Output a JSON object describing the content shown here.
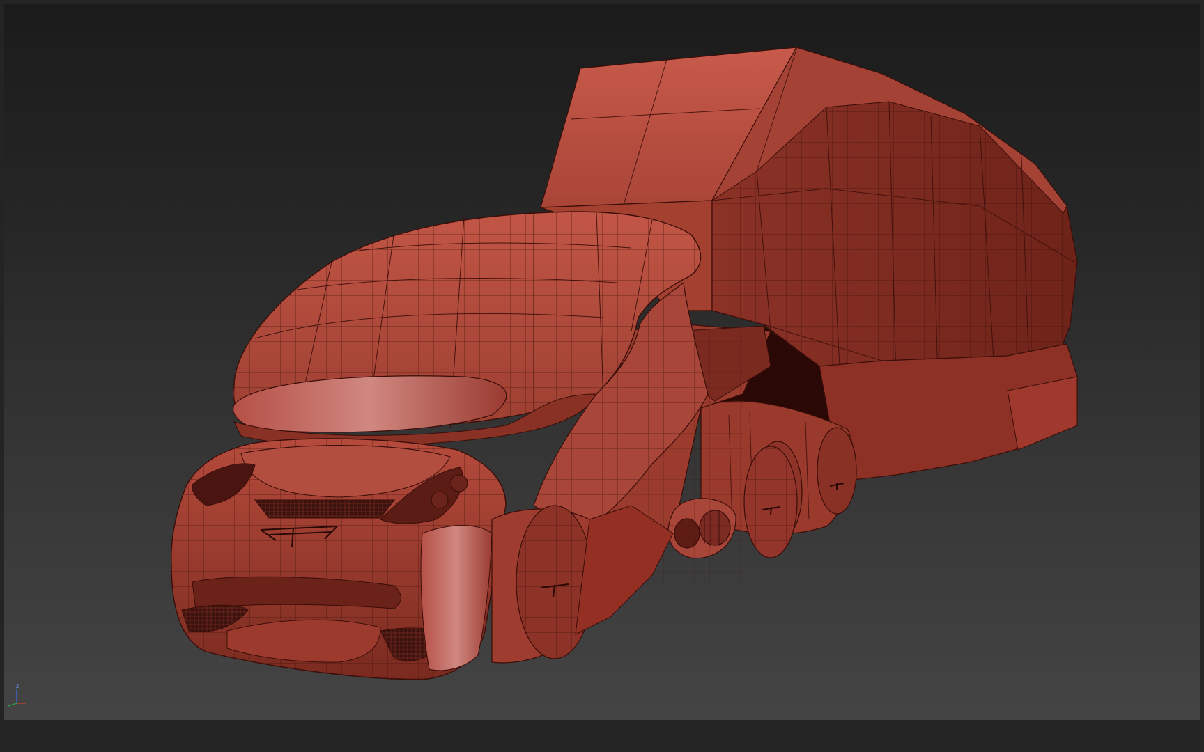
{
  "viewport": {
    "model": "wireframe-shaded-vehicle",
    "background": "gradient-dark-grey",
    "shading_color": "#b34a3c",
    "wire_color": "#3a0d08"
  },
  "axis_gizmo": {
    "z_label": "z",
    "x_color": "#d23a2a",
    "y_color": "#2fa34a",
    "z_color": "#3a6ae0"
  }
}
